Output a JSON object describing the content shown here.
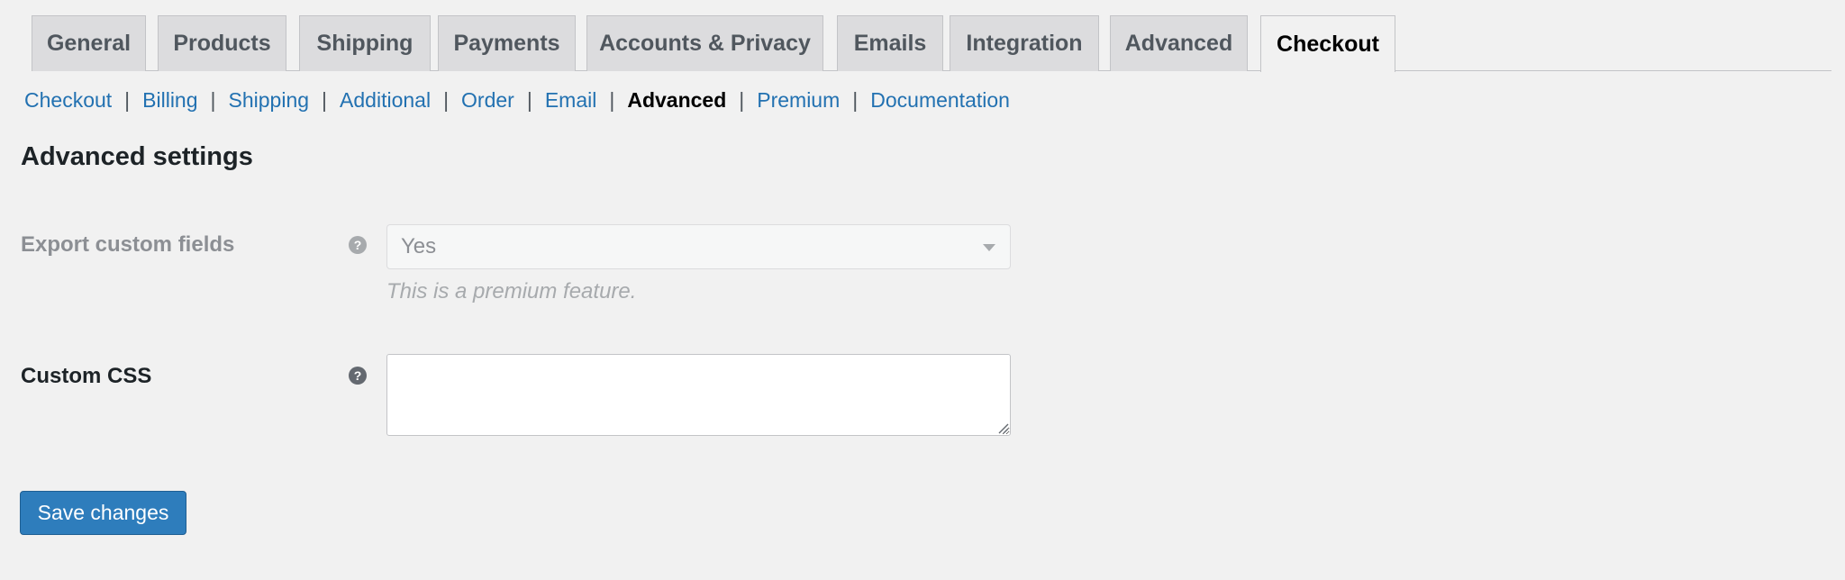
{
  "tabs": [
    {
      "label": "General"
    },
    {
      "label": "Products"
    },
    {
      "label": "Shipping"
    },
    {
      "label": "Payments"
    },
    {
      "label": "Accounts & Privacy"
    },
    {
      "label": "Emails"
    },
    {
      "label": "Integration"
    },
    {
      "label": "Advanced"
    },
    {
      "label": "Checkout",
      "active": true
    }
  ],
  "subnav": [
    {
      "label": "Checkout"
    },
    {
      "label": "Billing"
    },
    {
      "label": "Shipping"
    },
    {
      "label": "Additional"
    },
    {
      "label": "Order"
    },
    {
      "label": "Email"
    },
    {
      "label": "Advanced",
      "current": true
    },
    {
      "label": "Premium"
    },
    {
      "label": "Documentation"
    }
  ],
  "subnav_separator": "|",
  "section": {
    "title": "Advanced settings"
  },
  "fields": {
    "export_custom_fields": {
      "label": "Export custom fields",
      "help": "?",
      "value": "Yes",
      "description": "This is a premium feature."
    },
    "custom_css": {
      "label": "Custom CSS",
      "help": "?",
      "value": ""
    }
  },
  "actions": {
    "save_label": "Save changes"
  },
  "colors": {
    "accent": "#2271b1",
    "button": "#2e7dbc",
    "background": "#f1f1f1"
  }
}
